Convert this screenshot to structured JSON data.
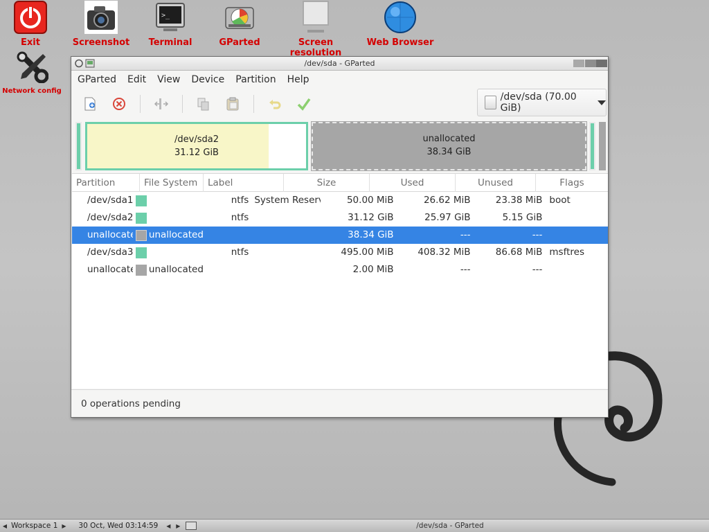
{
  "desktop": {
    "icons": [
      {
        "label": "Exit",
        "icon": "power-icon"
      },
      {
        "label": "Screenshot",
        "icon": "camera-icon"
      },
      {
        "label": "Terminal",
        "icon": "terminal-icon"
      },
      {
        "label": "GParted",
        "icon": "gparted-icon"
      },
      {
        "label": "Screen resolution",
        "icon": "monitor-icon"
      },
      {
        "label": "Web Browser",
        "icon": "globe-icon"
      },
      {
        "label": "Network config",
        "icon": "tools-icon"
      }
    ],
    "label_color": "#d40000"
  },
  "window": {
    "title": "/dev/sda - GParted",
    "menu": [
      "GParted",
      "Edit",
      "View",
      "Device",
      "Partition",
      "Help"
    ],
    "toolbar": [
      "new-partition-icon",
      "delete-icon",
      "resize-icon",
      "copy-icon",
      "paste-icon",
      "undo-icon",
      "apply-icon"
    ],
    "device_selector": "/dev/sda (70.00 GiB)"
  },
  "disk_map": {
    "partition": {
      "name": "/dev/sda2",
      "size": "31.12 GiB",
      "used_fraction": 0.83
    },
    "unallocated": {
      "name": "unallocated",
      "size": "38.34 GiB"
    }
  },
  "table": {
    "headers": [
      "Partition",
      "File System",
      "Label",
      "Size",
      "Used",
      "Unused",
      "Flags"
    ],
    "rows": [
      {
        "partition": "/dev/sda1",
        "fs": "ntfs",
        "fs_color": "#6ccfaa",
        "label": "System Reserved",
        "size": "50.00 MiB",
        "used": "26.62 MiB",
        "unused": "23.38 MiB",
        "flags": "boot"
      },
      {
        "partition": "/dev/sda2",
        "fs": "ntfs",
        "fs_color": "#6ccfaa",
        "label": "",
        "size": "31.12 GiB",
        "used": "25.97 GiB",
        "unused": "5.15 GiB",
        "flags": ""
      },
      {
        "partition": "unallocated",
        "fs": "unallocated",
        "fs_color": "#a6a6a6",
        "label": "",
        "size": "38.34 GiB",
        "used": "---",
        "unused": "---",
        "flags": "",
        "selected": true
      },
      {
        "partition": "/dev/sda3",
        "fs": "ntfs",
        "fs_color": "#6ccfaa",
        "label": "",
        "size": "495.00 MiB",
        "used": "408.32 MiB",
        "unused": "86.68 MiB",
        "flags": "msftres"
      },
      {
        "partition": "unallocated",
        "fs": "unallocated",
        "fs_color": "#a6a6a6",
        "label": "",
        "size": "2.00 MiB",
        "used": "---",
        "unused": "---",
        "flags": ""
      }
    ]
  },
  "status": "0 operations pending",
  "taskbar": {
    "workspace": "Workspace 1",
    "clock": "30 Oct, Wed 03:14:59",
    "task": "/dev/sda - GParted"
  },
  "colors": {
    "selection": "#3584e4",
    "ntfs": "#6ccfaa",
    "unallocated": "#a6a6a6"
  }
}
